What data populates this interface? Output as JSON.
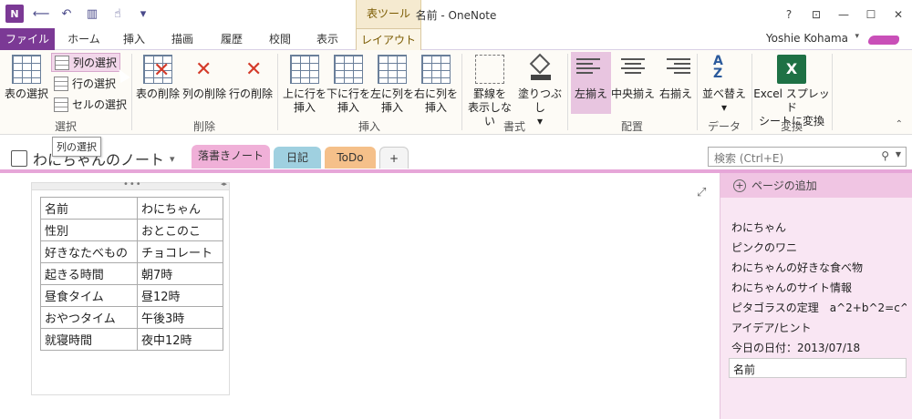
{
  "window": {
    "title": "名前 - OneNote",
    "context_tab": "表ツール",
    "controls": [
      "?",
      "⊡",
      "—",
      "☐",
      "✕"
    ]
  },
  "quick_access": {
    "icons": [
      "onenote-logo-icon",
      "back-icon",
      "undo-icon",
      "dock-icon",
      "touch-mode-icon",
      "customize-icon"
    ],
    "logo_text": "N"
  },
  "ribbon_tabs": {
    "file": "ファイル",
    "home": "ホーム",
    "insert": "挿入",
    "draw": "描画",
    "history": "履歴",
    "review": "校閲",
    "view": "表示",
    "layout": "レイアウト"
  },
  "user": {
    "name": "Yoshie Kohama",
    "caret": "▾"
  },
  "ribbon": {
    "select_group": {
      "label": "選択",
      "select_table": "表の選択",
      "select_column": "列の選択",
      "select_row": "行の選択",
      "select_cell": "セルの選択"
    },
    "delete_group": {
      "label": "削除",
      "delete_table": "表の削除",
      "delete_column": "列の削除",
      "delete_row": "行の削除"
    },
    "insert_group": {
      "label": "挿入",
      "insert_above_1": "上に行を",
      "insert_above_2": "挿入",
      "insert_below_1": "下に行を",
      "insert_below_2": "挿入",
      "insert_left_1": "左に列を",
      "insert_left_2": "挿入",
      "insert_right_1": "右に列を",
      "insert_right_2": "挿入"
    },
    "format_group": {
      "label": "書式",
      "hide_borders_1": "罫線を",
      "hide_borders_2": "表示しない",
      "shading": "塗りつぶし",
      "shading_caret": "▾"
    },
    "align_group": {
      "label": "配置",
      "align_left": "左揃え",
      "align_center": "中央揃え",
      "align_right": "右揃え"
    },
    "data_group": {
      "label": "データ",
      "sort": "並べ替え",
      "sort_caret": "▾"
    },
    "convert_group": {
      "label": "変換",
      "excel_1": "Excel スプレッド",
      "excel_2": "シートに変換"
    }
  },
  "tooltip": "列の選択",
  "notebook": {
    "title": "わにちゃんのノート",
    "caret": "▾",
    "sections": [
      {
        "label": "落書きノート",
        "color": "#f0b0d8"
      },
      {
        "label": "日記",
        "color": "#9fd0e0"
      },
      {
        "label": "ToDo",
        "color": "#f5c08a"
      },
      {
        "label": "+",
        "color": "#f4f4f4"
      }
    ]
  },
  "search": {
    "placeholder": "検索 (Ctrl+E)"
  },
  "table": {
    "rows": [
      [
        "名前",
        "わにちゃん"
      ],
      [
        "性別",
        "おとこのこ"
      ],
      [
        "好きなたべもの",
        "チョコレート"
      ],
      [
        "起きる時間",
        "朝7時"
      ],
      [
        "昼食タイム",
        "昼12時"
      ],
      [
        "おやつタイム",
        "午後3時"
      ],
      [
        "就寝時間",
        "夜中12時"
      ]
    ]
  },
  "pages": {
    "add_label": "ページの追加",
    "items": [
      "わにちゃん",
      "ピンクのワニ",
      "わにちゃんの好きな食べ物",
      "わにちゃんのサイト情報",
      "ピタゴラスの定理　a^2+b^2=c^2",
      "アイデア/ヒント",
      "今日の日付：2013/07/18",
      "名前"
    ]
  },
  "colors": {
    "brand": "#7b3995",
    "section_accent": "#e6a6d8",
    "context_tab": "#f5ead0"
  }
}
